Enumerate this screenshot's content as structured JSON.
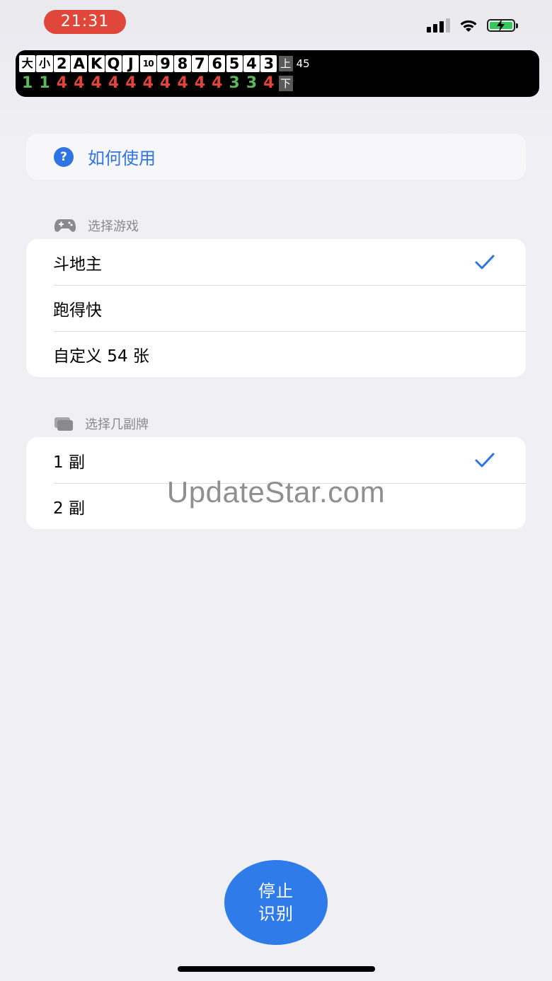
{
  "status_bar": {
    "time": "21:31"
  },
  "counter": {
    "top": [
      {
        "label": "大",
        "size": "small"
      },
      {
        "label": "小",
        "size": "small"
      },
      {
        "label": "2"
      },
      {
        "label": "A"
      },
      {
        "label": "K"
      },
      {
        "label": "Q"
      },
      {
        "label": "J"
      },
      {
        "label": "10",
        "size": "tiny"
      },
      {
        "label": "9"
      },
      {
        "label": "8"
      },
      {
        "label": "7"
      },
      {
        "label": "6"
      },
      {
        "label": "5"
      },
      {
        "label": "4"
      },
      {
        "label": "3"
      }
    ],
    "bottom": [
      {
        "value": "1",
        "color": "green"
      },
      {
        "value": "1",
        "color": "green"
      },
      {
        "value": "4",
        "color": "red"
      },
      {
        "value": "4",
        "color": "red"
      },
      {
        "value": "4",
        "color": "red"
      },
      {
        "value": "4",
        "color": "red"
      },
      {
        "value": "4",
        "color": "red"
      },
      {
        "value": "4",
        "color": "red"
      },
      {
        "value": "4",
        "color": "red"
      },
      {
        "value": "4",
        "color": "red"
      },
      {
        "value": "4",
        "color": "red"
      },
      {
        "value": "4",
        "color": "red"
      },
      {
        "value": "3",
        "color": "green"
      },
      {
        "value": "3",
        "color": "green"
      },
      {
        "value": "4",
        "color": "red"
      }
    ],
    "upper_tag": "上",
    "lower_tag": "下",
    "remaining": "45"
  },
  "help": {
    "label": "如何使用",
    "icon": "question-icon"
  },
  "game_section": {
    "header": "选择游戏",
    "icon": "gamepad-icon",
    "items": [
      {
        "label": "斗地主",
        "checked": true
      },
      {
        "label": "跑得快",
        "checked": false
      },
      {
        "label": "自定义 54 张",
        "checked": false
      }
    ]
  },
  "deck_section": {
    "header": "选择几副牌",
    "icon": "cards-stack-icon",
    "items": [
      {
        "label": "1 副",
        "checked": true
      },
      {
        "label": "2 副",
        "checked": false
      }
    ]
  },
  "watermark": "UpdateStar.com",
  "stop_button": {
    "line1": "停止",
    "line2": "识别"
  },
  "colors": {
    "accent": "#2f74e3",
    "green": "#5ab95b",
    "red": "#e2443a",
    "record": "#e0463a"
  }
}
